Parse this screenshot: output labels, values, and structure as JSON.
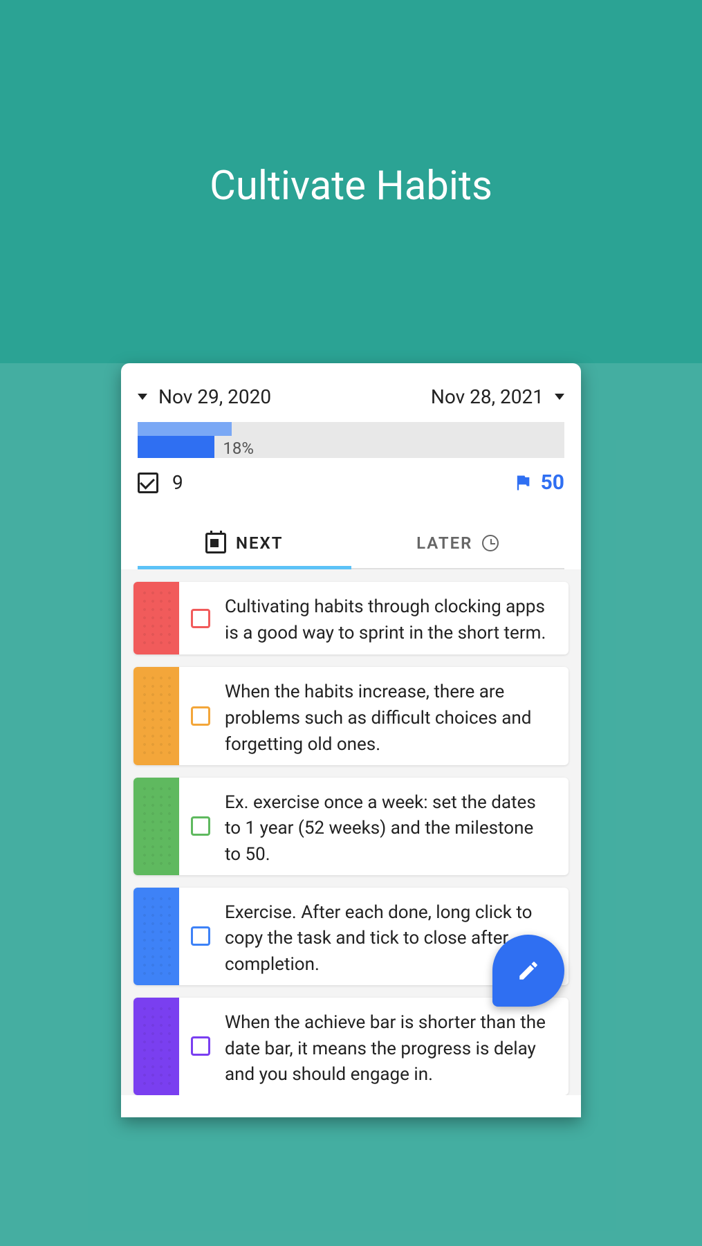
{
  "page_title": "Cultivate Habits",
  "date_start": "Nov 29, 2020",
  "date_end": "Nov 28, 2021",
  "progress": {
    "top_pct": 22,
    "bottom_pct": 18,
    "label": "18%",
    "label_left_pct": 20
  },
  "stats": {
    "completed": "9",
    "milestone": "50"
  },
  "tabs": {
    "next": "NEXT",
    "later": "LATER"
  },
  "habits": [
    {
      "color": "#f15b5b",
      "check_color": "#f15b5b",
      "text": "Cultivating habits through clocking apps is a good way to sprint in the short term."
    },
    {
      "color": "#f3a63a",
      "check_color": "#f3a63a",
      "text": "When the habits increase, there are problems such as difficult choices and forgetting old ones."
    },
    {
      "color": "#5fb95f",
      "check_color": "#5fb95f",
      "text": "Ex. exercise once a week: set the dates to 1 year (52 weeks) and the milestone to 50."
    },
    {
      "color": "#3e82f7",
      "check_color": "#3e82f7",
      "text": "Exercise. After each done, long click to copy the task and tick to close after completion."
    },
    {
      "color": "#7a3ff0",
      "check_color": "#7a3ff0",
      "text": "When the achieve bar is shorter than the date bar, it means the progress is delay and you should engage in."
    }
  ]
}
